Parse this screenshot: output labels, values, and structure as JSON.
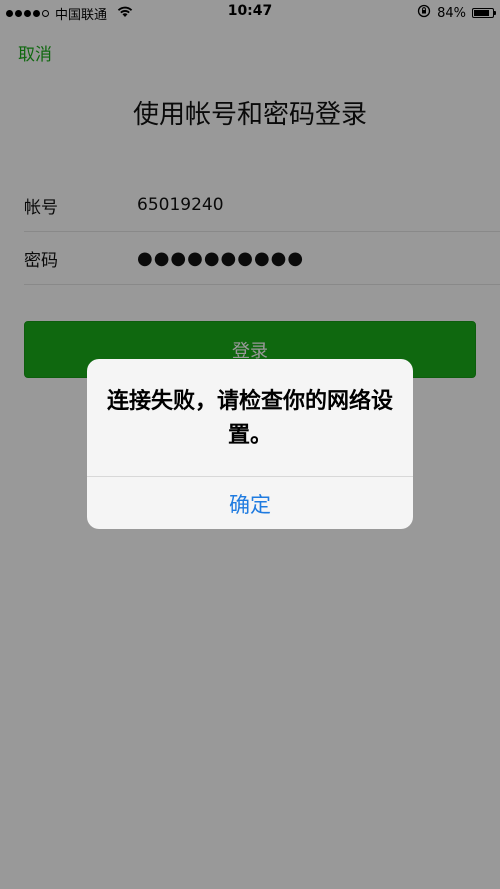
{
  "status_bar": {
    "carrier": "中国联通",
    "time": "10:47",
    "battery": "84%",
    "battery_level": 0.84
  },
  "nav": {
    "cancel_label": "取消"
  },
  "page": {
    "title": "使用帐号和密码登录"
  },
  "form": {
    "account_label": "帐号",
    "account_value": "65019240",
    "password_label": "密码",
    "password_value": "●●●●●●●●●●"
  },
  "login_button": {
    "label": "登录"
  },
  "alert": {
    "message": "连接失败，请检查你的网络设置。",
    "confirm_label": "确定"
  },
  "colors": {
    "accent": "#1aad19",
    "alert_button": "#1f7be0"
  }
}
